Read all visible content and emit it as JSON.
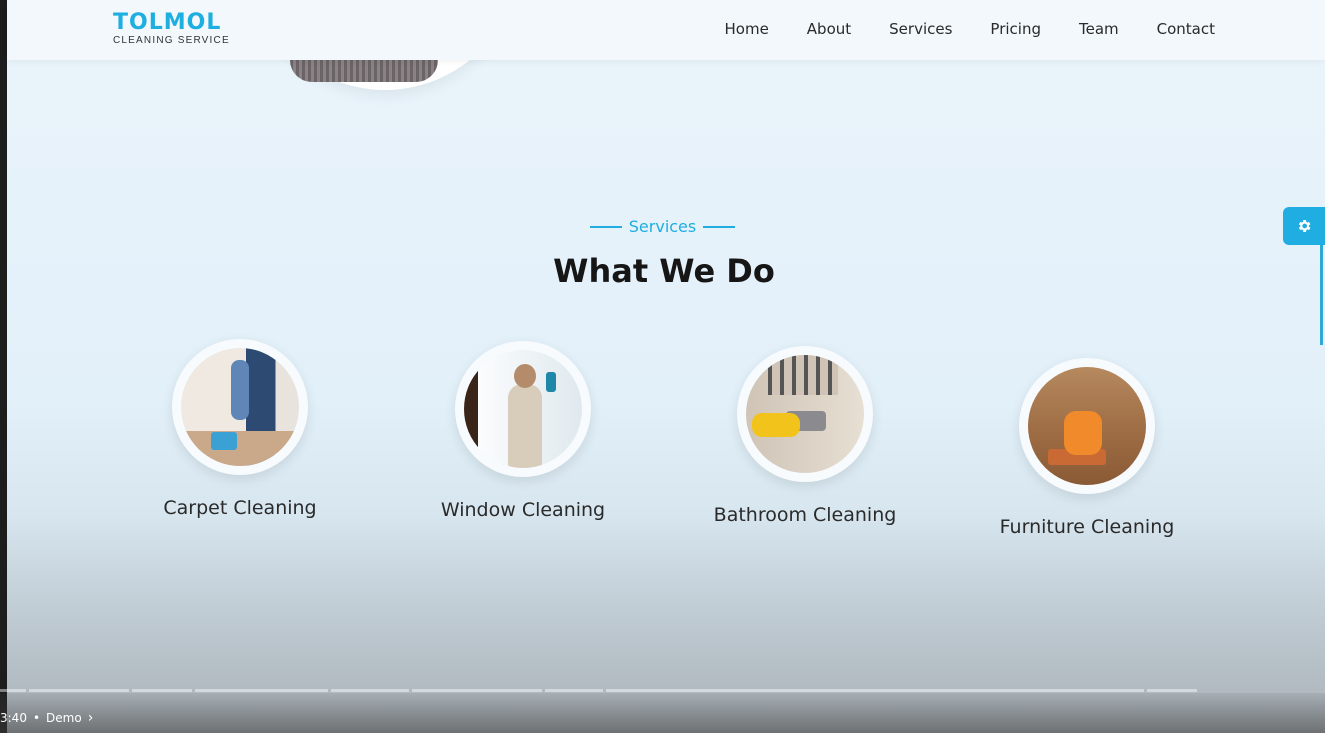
{
  "header": {
    "logo_main": "TOLMOL",
    "logo_sub": "CLEANING SERVICE",
    "nav": [
      "Home",
      "About",
      "Services",
      "Pricing",
      "Team",
      "Contact"
    ]
  },
  "section": {
    "eyebrow": "Services",
    "title": "What We Do"
  },
  "services": [
    {
      "title": "Carpet Cleaning"
    },
    {
      "title": "Window Cleaning"
    },
    {
      "title": "Bathroom Cleaning"
    },
    {
      "title": "Furniture Cleaning"
    }
  ],
  "video": {
    "time": "3:40",
    "separator": "•",
    "chapter": "Demo"
  },
  "colors": {
    "brand": "#1eaee0",
    "heading": "#161616"
  },
  "icons": {
    "settings": "gear-icon",
    "chapter_next": "chevron-right-icon"
  }
}
